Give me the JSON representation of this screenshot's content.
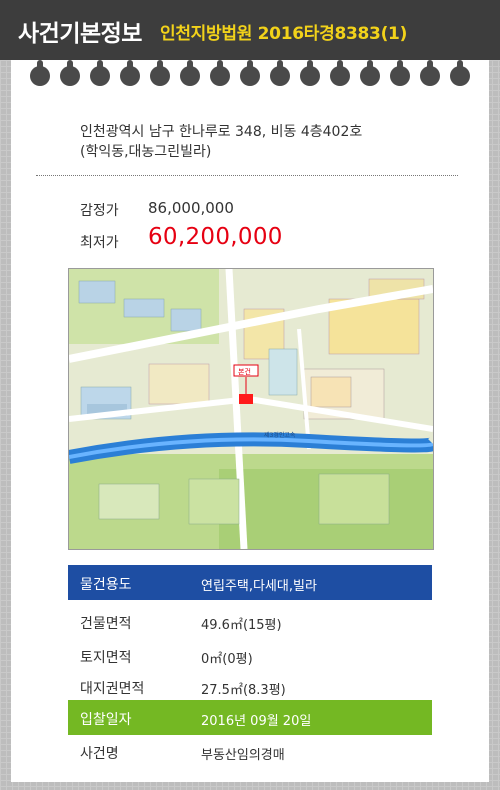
{
  "header": {
    "title": "사건기본정보",
    "case": "인천지방법원 2016타경8383(1)"
  },
  "address": {
    "line1": "인천광역시 남구 한나루로 348, 비동 4층402호",
    "line2": "(학익동,대농그린빌라)"
  },
  "price": {
    "appraisal_label": "감정가",
    "appraisal_value": "86,000,000",
    "minimum_label": "최저가",
    "minimum_value": "60,200,000"
  },
  "map": {
    "marker_label": "본건",
    "road_label": "제3경인고속"
  },
  "info_rows": [
    {
      "label": "물건용도",
      "value": "연립주택,다세대,빌라"
    },
    {
      "label": "건물면적",
      "value": "49.6㎡(15평)"
    },
    {
      "label": "토지면적",
      "value": "0㎡(0평)"
    },
    {
      "label": "대지권면적",
      "value": "27.5㎡(8.3평)"
    },
    {
      "label": "입찰일자",
      "value": "2016년 09월 20일"
    },
    {
      "label": "사건명",
      "value": "부동산임의경매"
    }
  ],
  "colors": {
    "header_bg": "#3d3d3d",
    "case_text": "#f2d21a",
    "min_price": "#e60012",
    "row_blue": "#1e4ea3",
    "row_green": "#74b823"
  }
}
